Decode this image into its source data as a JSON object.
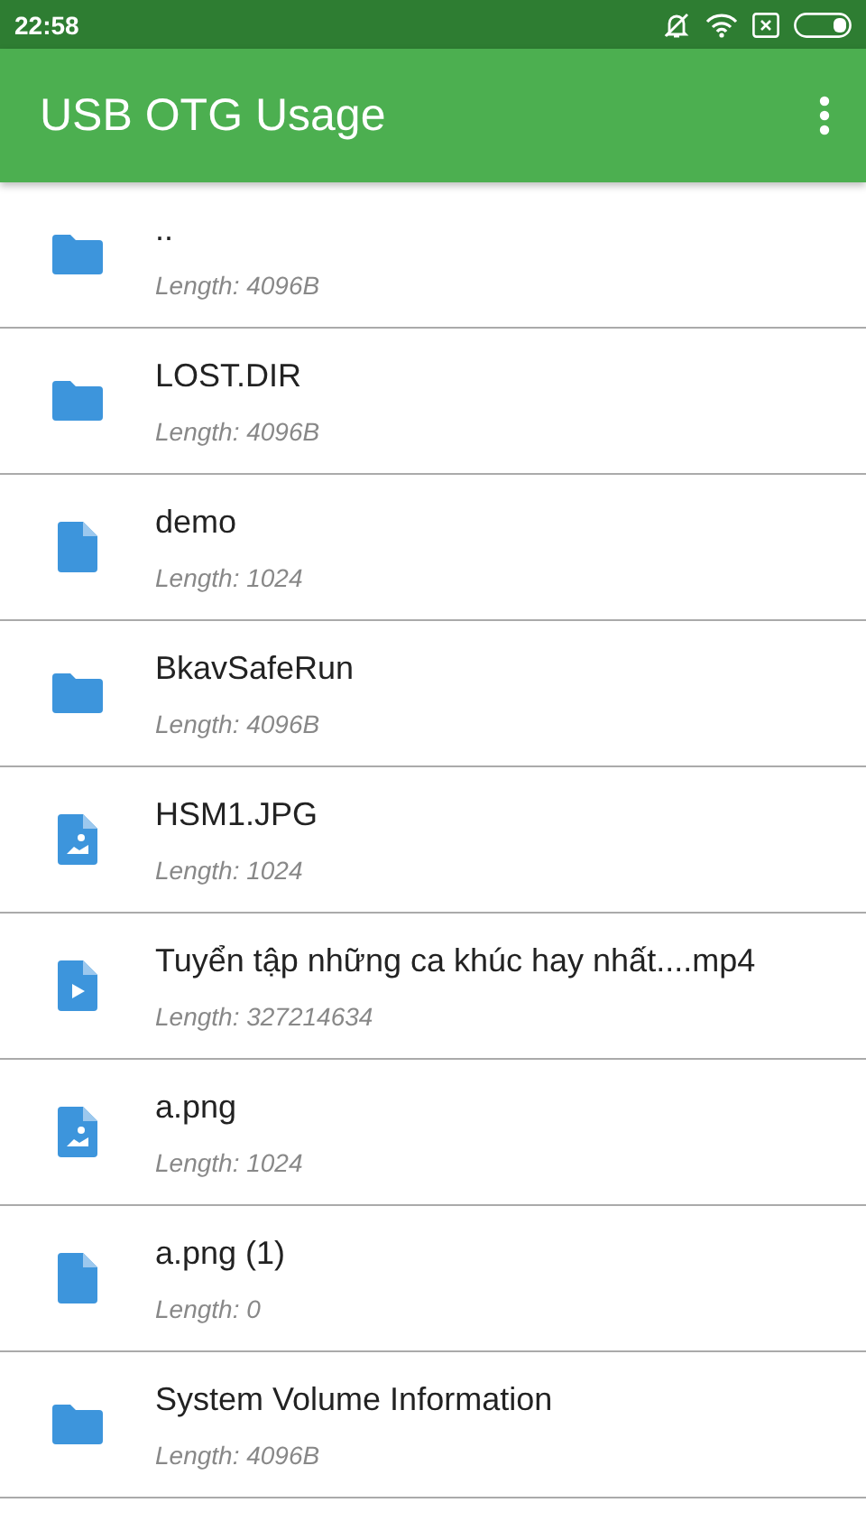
{
  "status_bar": {
    "time": "22:58"
  },
  "app_bar": {
    "title": "USB OTG Usage"
  },
  "files": [
    {
      "kind": "folder",
      "name": "..",
      "length": "Length: 4096B"
    },
    {
      "kind": "folder",
      "name": "LOST.DIR",
      "length": "Length: 4096B"
    },
    {
      "kind": "file",
      "name": "demo",
      "length": "Length: 1024"
    },
    {
      "kind": "folder",
      "name": "BkavSafeRun",
      "length": "Length: 4096B"
    },
    {
      "kind": "image",
      "name": "HSM1.JPG",
      "length": "Length: 1024"
    },
    {
      "kind": "video",
      "name": "Tuyển tập những ca khúc hay nhất....mp4",
      "length": "Length: 327214634"
    },
    {
      "kind": "image",
      "name": "a.png",
      "length": "Length: 1024"
    },
    {
      "kind": "file",
      "name": "a.png (1)",
      "length": "Length: 0"
    },
    {
      "kind": "folder",
      "name": "System Volume Information",
      "length": "Length: 4096B"
    }
  ]
}
